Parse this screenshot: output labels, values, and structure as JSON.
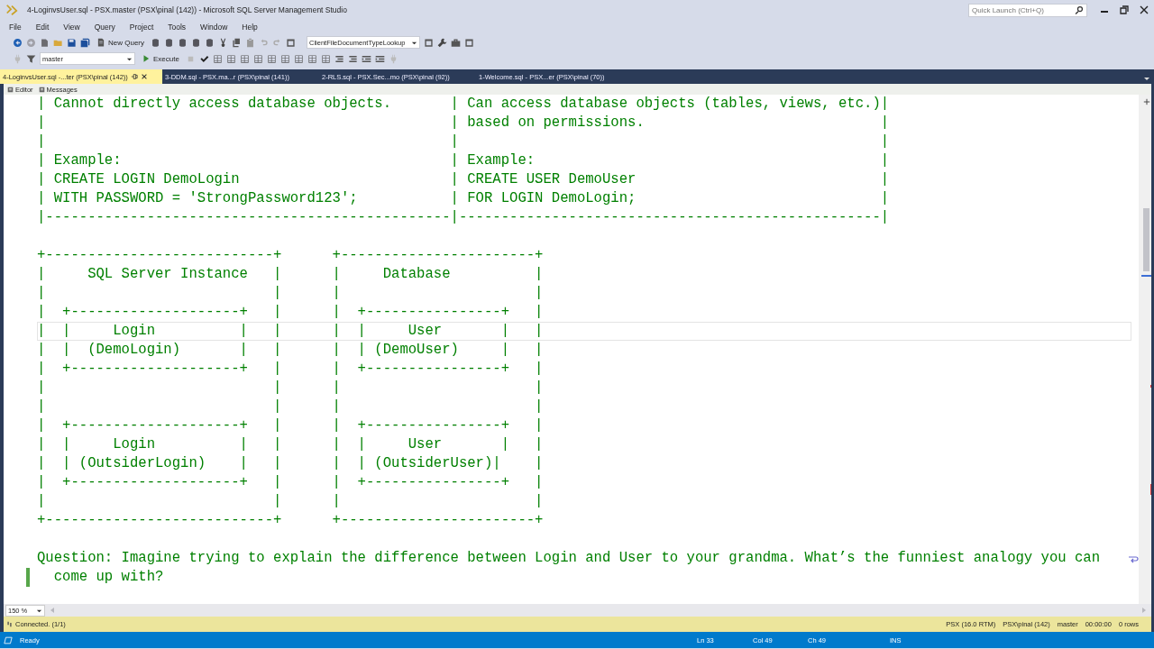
{
  "window": {
    "title": "4-LoginvsUser.sql - PSX.master (PSX\\pinal (142)) - Microsoft SQL Server Management Studio"
  },
  "quick_launch": {
    "placeholder": "Quick Launch (Ctrl+Q)"
  },
  "menu": [
    "File",
    "Edit",
    "View",
    "Query",
    "Project",
    "Tools",
    "Window",
    "Help"
  ],
  "toolbar": {
    "new_query": "New Query",
    "solution_config": "ClientFileDocumentTypeLookup",
    "database": "master",
    "execute": "Execute"
  },
  "tabs": [
    {
      "label": "4-LoginvsUser.sql -...ter (PSX\\pinal (142))",
      "selected": true
    },
    {
      "label": "3-DDM.sql - PSX.ma...r (PSX\\pinal (141))",
      "selected": false
    },
    {
      "label": "2-RLS.sql - PSX.Sec...mo (PSX\\pinal (92))",
      "selected": false
    },
    {
      "label": "1-Welcome.sql - PSX...er (PSX\\pinal (70))",
      "selected": false
    }
  ],
  "subtabs": [
    "Editor",
    "Messages"
  ],
  "editor": {
    "table_lines": [
      {
        "text": "| Cannot directly access database objects.       | Can access database objects (tables, views, etc.)|",
        "current": false
      },
      {
        "text": "|                                                | based on permissions.                            |",
        "current": false
      },
      {
        "text": "|                                                |                                                  |",
        "current": false
      },
      {
        "text": "| Example:                                       | Example:                                         |",
        "current": false
      },
      {
        "text": "| CREATE LOGIN DemoLogin                         | CREATE USER DemoUser                             |",
        "current": false
      },
      {
        "text": "| WITH PASSWORD = 'StrongPassword123';           | FOR LOGIN DemoLogin;                             |",
        "current": false
      },
      {
        "text": "|------------------------------------------------|--------------------------------------------------|",
        "current": false
      }
    ],
    "diagram_lines": [
      {
        "text": "+---------------------------+      +-----------------------+",
        "current": false
      },
      {
        "text": "|     SQL Server Instance   |      |     Database          |",
        "current": false
      },
      {
        "text": "|                           |      |                       |",
        "current": false
      },
      {
        "text": "|  +--------------------+   |      |  +----------------+   |",
        "current": false
      },
      {
        "text": "|  |     Login          |   |      |  |     User       |   |",
        "current": true
      },
      {
        "text": "|  |  (DemoLogin)       |   |      |  | (DemoUser)     |   |",
        "current": false
      },
      {
        "text": "|  +--------------------+   |      |  +----------------+   |",
        "current": false
      },
      {
        "text": "|                           |      |                       |",
        "current": false
      },
      {
        "text": "|                           |      |                       |",
        "current": false
      },
      {
        "text": "|  +--------------------+   |      |  +----------------+   |",
        "current": false
      },
      {
        "text": "|  |     Login          |   |      |  |     User       |   |",
        "current": false
      },
      {
        "text": "|  | (OutsiderLogin)    |   |      |  | (OutsiderUser)|    |",
        "current": false
      },
      {
        "text": "|  +--------------------+   |      |  +----------------+   |",
        "current": false
      },
      {
        "text": "|                           |      |                       |",
        "current": false
      },
      {
        "text": "+---------------------------+      +-----------------------+",
        "current": false
      }
    ],
    "question": "Question: Imagine trying to explain the difference between Login and User to your grandma. What’s the funniest analogy you can come up with?"
  },
  "zoom": "150 %",
  "connection": {
    "status": "Connected. (1/1)",
    "server": "PSX (16.0 RTM)",
    "user": "PSX\\pinal (142)",
    "database": "master",
    "elapsed": "00:00:00",
    "rows": "0 rows"
  },
  "status_bar": {
    "state": "Ready",
    "ln": "Ln 33",
    "col": "Col 49",
    "ch": "Ch 49",
    "mode": "INS"
  }
}
